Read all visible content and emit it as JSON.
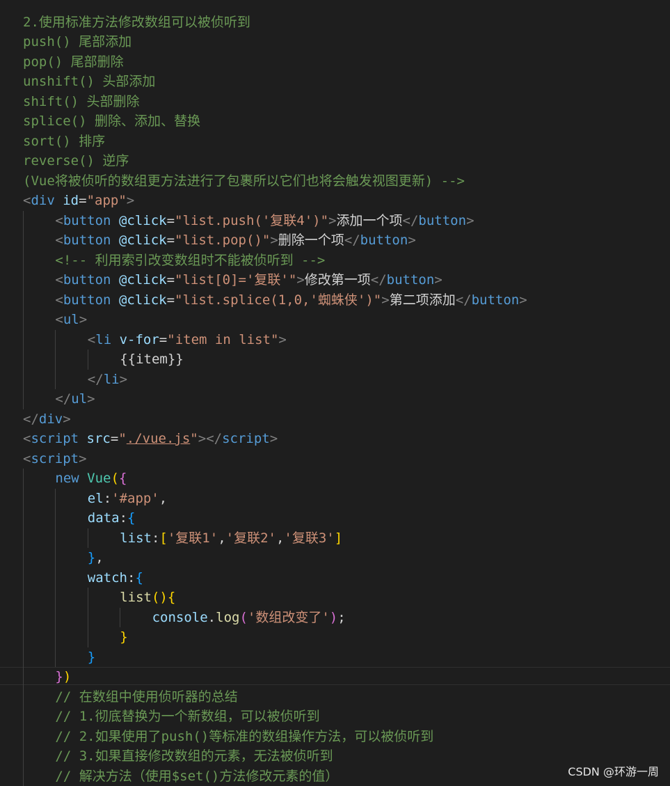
{
  "editor": {
    "lines": [
      {
        "tokens": [
          {
            "t": "2.使用标准方法修改数组可以被侦听到",
            "c": "com"
          }
        ]
      },
      {
        "tokens": [
          {
            "t": "push() 尾部添加",
            "c": "com"
          }
        ]
      },
      {
        "tokens": [
          {
            "t": "pop() 尾部删除",
            "c": "com"
          }
        ]
      },
      {
        "tokens": [
          {
            "t": "unshift() 头部添加",
            "c": "com"
          }
        ]
      },
      {
        "tokens": [
          {
            "t": "shift() 头部删除",
            "c": "com"
          }
        ]
      },
      {
        "tokens": [
          {
            "t": "splice() 删除、添加、替换",
            "c": "com"
          }
        ]
      },
      {
        "tokens": [
          {
            "t": "sort() 排序",
            "c": "com"
          }
        ]
      },
      {
        "tokens": [
          {
            "t": "reverse() 逆序",
            "c": "com"
          }
        ]
      },
      {
        "tokens": [
          {
            "t": "(Vue将被侦听的数组更方法进行了包裹所以它们也将会触发视图更新) -->",
            "c": "com"
          }
        ]
      },
      {
        "tokens": [
          {
            "t": "<",
            "c": "brk"
          },
          {
            "t": "div",
            "c": "tag"
          },
          {
            "t": " ",
            "c": "txt"
          },
          {
            "t": "id",
            "c": "attr"
          },
          {
            "t": "=",
            "c": "txt"
          },
          {
            "t": "\"app\"",
            "c": "str"
          },
          {
            "t": ">",
            "c": "brk"
          }
        ]
      },
      {
        "indent": 4,
        "tokens": [
          {
            "t": "<",
            "c": "brk"
          },
          {
            "t": "button",
            "c": "tag"
          },
          {
            "t": " ",
            "c": "txt"
          },
          {
            "t": "@click",
            "c": "attr"
          },
          {
            "t": "=",
            "c": "txt"
          },
          {
            "t": "\"list.push('复联4')\"",
            "c": "str"
          },
          {
            "t": ">",
            "c": "brk"
          },
          {
            "t": "添加一个项",
            "c": "txt"
          },
          {
            "t": "</",
            "c": "brk"
          },
          {
            "t": "button",
            "c": "tag"
          },
          {
            "t": ">",
            "c": "brk"
          }
        ]
      },
      {
        "indent": 4,
        "tokens": [
          {
            "t": "<",
            "c": "brk"
          },
          {
            "t": "button",
            "c": "tag"
          },
          {
            "t": " ",
            "c": "txt"
          },
          {
            "t": "@click",
            "c": "attr"
          },
          {
            "t": "=",
            "c": "txt"
          },
          {
            "t": "\"list.pop()\"",
            "c": "str"
          },
          {
            "t": ">",
            "c": "brk"
          },
          {
            "t": "删除一个项",
            "c": "txt"
          },
          {
            "t": "</",
            "c": "brk"
          },
          {
            "t": "button",
            "c": "tag"
          },
          {
            "t": ">",
            "c": "brk"
          }
        ]
      },
      {
        "indent": 4,
        "tokens": [
          {
            "t": "<!-- 利用索引改变数组时不能被侦听到 -->",
            "c": "com"
          }
        ]
      },
      {
        "indent": 4,
        "tokens": [
          {
            "t": "<",
            "c": "brk"
          },
          {
            "t": "button",
            "c": "tag"
          },
          {
            "t": " ",
            "c": "txt"
          },
          {
            "t": "@click",
            "c": "attr"
          },
          {
            "t": "=",
            "c": "txt"
          },
          {
            "t": "\"list[0]='复联'\"",
            "c": "str"
          },
          {
            "t": ">",
            "c": "brk"
          },
          {
            "t": "修改第一项",
            "c": "txt"
          },
          {
            "t": "</",
            "c": "brk"
          },
          {
            "t": "button",
            "c": "tag"
          },
          {
            "t": ">",
            "c": "brk"
          }
        ]
      },
      {
        "indent": 4,
        "tokens": [
          {
            "t": "<",
            "c": "brk"
          },
          {
            "t": "button",
            "c": "tag"
          },
          {
            "t": " ",
            "c": "txt"
          },
          {
            "t": "@click",
            "c": "attr"
          },
          {
            "t": "=",
            "c": "txt"
          },
          {
            "t": "\"list.splice(1,0,'蜘蛛侠')\"",
            "c": "str"
          },
          {
            "t": ">",
            "c": "brk"
          },
          {
            "t": "第二项添加",
            "c": "txt"
          },
          {
            "t": "</",
            "c": "brk"
          },
          {
            "t": "button",
            "c": "tag"
          },
          {
            "t": ">",
            "c": "brk"
          }
        ]
      },
      {
        "indent": 4,
        "tokens": [
          {
            "t": "<",
            "c": "brk"
          },
          {
            "t": "ul",
            "c": "tag"
          },
          {
            "t": ">",
            "c": "brk"
          }
        ]
      },
      {
        "indent": 8,
        "tokens": [
          {
            "t": "<",
            "c": "brk"
          },
          {
            "t": "li",
            "c": "tag"
          },
          {
            "t": " ",
            "c": "txt"
          },
          {
            "t": "v-for",
            "c": "attr"
          },
          {
            "t": "=",
            "c": "txt"
          },
          {
            "t": "\"item in list\"",
            "c": "str"
          },
          {
            "t": ">",
            "c": "brk"
          }
        ]
      },
      {
        "indent": 12,
        "tokens": [
          {
            "t": "{{item}}",
            "c": "txt"
          }
        ]
      },
      {
        "indent": 8,
        "tokens": [
          {
            "t": "</",
            "c": "brk"
          },
          {
            "t": "li",
            "c": "tag"
          },
          {
            "t": ">",
            "c": "brk"
          }
        ]
      },
      {
        "indent": 4,
        "tokens": [
          {
            "t": "</",
            "c": "brk"
          },
          {
            "t": "ul",
            "c": "tag"
          },
          {
            "t": ">",
            "c": "brk"
          }
        ]
      },
      {
        "tokens": [
          {
            "t": "</",
            "c": "brk"
          },
          {
            "t": "div",
            "c": "tag"
          },
          {
            "t": ">",
            "c": "brk"
          }
        ]
      },
      {
        "tokens": [
          {
            "t": "<",
            "c": "brk"
          },
          {
            "t": "script",
            "c": "tag"
          },
          {
            "t": " ",
            "c": "txt"
          },
          {
            "t": "src",
            "c": "attr"
          },
          {
            "t": "=",
            "c": "txt"
          },
          {
            "t": "\"",
            "c": "str"
          },
          {
            "t": "./vue.js",
            "c": "str",
            "u": true
          },
          {
            "t": "\"",
            "c": "str"
          },
          {
            "t": "></",
            "c": "brk"
          },
          {
            "t": "script",
            "c": "tag"
          },
          {
            "t": ">",
            "c": "brk"
          }
        ]
      },
      {
        "tokens": [
          {
            "t": "<",
            "c": "brk"
          },
          {
            "t": "script",
            "c": "tag"
          },
          {
            "t": ">",
            "c": "brk"
          }
        ]
      },
      {
        "indent": 4,
        "tokens": [
          {
            "t": "new",
            "c": "kw"
          },
          {
            "t": " ",
            "c": "txt"
          },
          {
            "t": "Vue",
            "c": "cls"
          },
          {
            "t": "(",
            "c": "b1"
          },
          {
            "t": "{",
            "c": "b2"
          }
        ]
      },
      {
        "indent": 8,
        "tokens": [
          {
            "t": "el",
            "c": "prop"
          },
          {
            "t": ":",
            "c": "txt"
          },
          {
            "t": "'#app'",
            "c": "str"
          },
          {
            "t": ",",
            "c": "txt"
          }
        ]
      },
      {
        "indent": 8,
        "tokens": [
          {
            "t": "data",
            "c": "prop"
          },
          {
            "t": ":",
            "c": "txt"
          },
          {
            "t": "{",
            "c": "b3"
          }
        ]
      },
      {
        "indent": 12,
        "tokens": [
          {
            "t": "list",
            "c": "prop"
          },
          {
            "t": ":",
            "c": "txt"
          },
          {
            "t": "[",
            "c": "b1"
          },
          {
            "t": "'复联1'",
            "c": "str"
          },
          {
            "t": ",",
            "c": "txt"
          },
          {
            "t": "'复联2'",
            "c": "str"
          },
          {
            "t": ",",
            "c": "txt"
          },
          {
            "t": "'复联3'",
            "c": "str"
          },
          {
            "t": "]",
            "c": "b1"
          }
        ]
      },
      {
        "indent": 8,
        "tokens": [
          {
            "t": "}",
            "c": "b3"
          },
          {
            "t": ",",
            "c": "txt"
          }
        ]
      },
      {
        "indent": 8,
        "tokens": [
          {
            "t": "watch",
            "c": "prop"
          },
          {
            "t": ":",
            "c": "txt"
          },
          {
            "t": "{",
            "c": "b3"
          }
        ]
      },
      {
        "indent": 12,
        "tokens": [
          {
            "t": "list",
            "c": "fn"
          },
          {
            "t": "()",
            "c": "b1"
          },
          {
            "t": "{",
            "c": "b1"
          }
        ]
      },
      {
        "indent": 16,
        "tokens": [
          {
            "t": "console",
            "c": "prop"
          },
          {
            "t": ".",
            "c": "txt"
          },
          {
            "t": "log",
            "c": "fn"
          },
          {
            "t": "(",
            "c": "b2"
          },
          {
            "t": "'数组改变了'",
            "c": "str"
          },
          {
            "t": ")",
            "c": "b2"
          },
          {
            "t": ";",
            "c": "txt"
          }
        ]
      },
      {
        "indent": 12,
        "tokens": [
          {
            "t": "}",
            "c": "b1"
          }
        ]
      },
      {
        "indent": 8,
        "tokens": [
          {
            "t": "}",
            "c": "b3"
          }
        ]
      },
      {
        "indent": 4,
        "tokens": [
          {
            "t": "}",
            "c": "b2"
          },
          {
            "t": ")",
            "c": "b1"
          }
        ]
      },
      {
        "indent": 4,
        "tokens": [
          {
            "t": "// 在数组中使用侦听器的总结",
            "c": "com"
          }
        ]
      },
      {
        "indent": 4,
        "tokens": [
          {
            "t": "// 1.彻底替换为一个新数组，可以被侦听到",
            "c": "com"
          }
        ]
      },
      {
        "indent": 4,
        "tokens": [
          {
            "t": "// 2.如果使用了push()等标准的数组操作方法，可以被侦听到",
            "c": "com"
          }
        ]
      },
      {
        "indent": 4,
        "tokens": [
          {
            "t": "// 3.如果直接修改数组的元素，无法被侦听到",
            "c": "com"
          }
        ]
      },
      {
        "indent": 4,
        "tokens": [
          {
            "t": "// 解决方法（使用$set()方法修改元素的值）",
            "c": "com"
          }
        ]
      }
    ]
  },
  "watermark": "CSDN @环游一周"
}
